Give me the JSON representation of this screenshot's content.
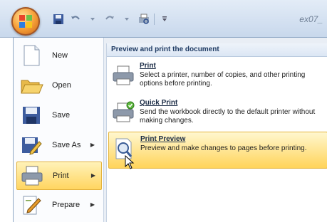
{
  "window": {
    "doc_title": "ex07_"
  },
  "menu": {
    "items": [
      {
        "label": "New",
        "icon": "new-document-icon"
      },
      {
        "label": "Open",
        "icon": "open-folder-icon"
      },
      {
        "label": "Save",
        "icon": "save-disk-icon"
      },
      {
        "label": "Save As",
        "icon": "save-as-icon"
      },
      {
        "label": "Print",
        "icon": "printer-icon"
      },
      {
        "label": "Prepare",
        "icon": "prepare-icon"
      }
    ],
    "submenu": {
      "header": "Preview and print the document",
      "options": [
        {
          "title": "Print",
          "description": "Select a printer, number of copies, and other printing options before printing."
        },
        {
          "title": "Quick Print",
          "description": "Send the workbook directly to the default printer without making changes."
        },
        {
          "title": "Print Preview",
          "description": "Preview and make changes to pages before printing."
        }
      ]
    }
  },
  "colors": {
    "highlight": "#ffd560",
    "menu_bg": "#e9eef5",
    "header_text": "#1f3b63"
  }
}
